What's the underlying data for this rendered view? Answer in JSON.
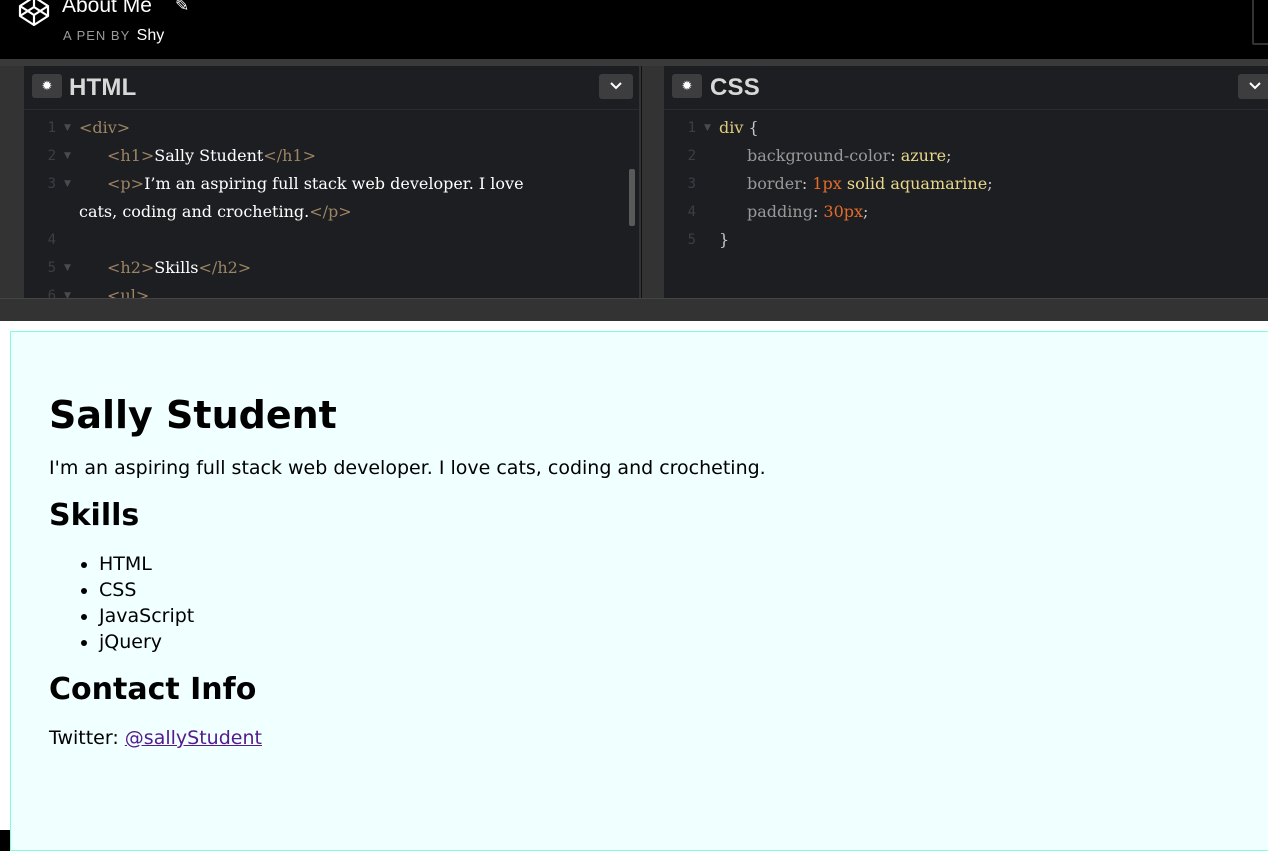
{
  "header": {
    "pen_title": "About Me",
    "byline_prefix": "A PEN BY",
    "author": "Shy"
  },
  "editors": {
    "html": {
      "title": "HTML",
      "lines": [
        {
          "n": "1",
          "fold": true,
          "parts": [
            [
              "tag",
              "<div>"
            ]
          ]
        },
        {
          "n": "2",
          "fold": true,
          "indent": true,
          "parts": [
            [
              "tag",
              "<h1>"
            ],
            [
              "text",
              "Sally Student"
            ],
            [
              "tag",
              "</h1>"
            ]
          ]
        },
        {
          "n": "3",
          "fold": true,
          "indent": true,
          "parts": [
            [
              "tag",
              "<p>"
            ],
            [
              "text",
              "I’m an aspiring full stack web developer. I love"
            ]
          ]
        },
        {
          "n": "",
          "fold": false,
          "parts": [
            [
              "text",
              "cats, coding and crocheting."
            ],
            [
              "tag",
              "</p>"
            ]
          ]
        },
        {
          "n": "4",
          "fold": false,
          "parts": []
        },
        {
          "n": "5",
          "fold": true,
          "indent": true,
          "parts": [
            [
              "tag",
              "<h2>"
            ],
            [
              "text",
              "Skills"
            ],
            [
              "tag",
              "</h2>"
            ]
          ]
        },
        {
          "n": "6",
          "fold": true,
          "indent": true,
          "parts": [
            [
              "tag",
              "<ul>"
            ]
          ]
        }
      ]
    },
    "css": {
      "title": "CSS",
      "lines": [
        {
          "n": "1",
          "fold": true,
          "parts": [
            [
              "sel",
              "div"
            ],
            [
              "punc",
              " {"
            ]
          ]
        },
        {
          "n": "2",
          "fold": false,
          "indent": true,
          "parts": [
            [
              "prop",
              "background-color"
            ],
            [
              "punc",
              ": "
            ],
            [
              "val",
              "azure"
            ],
            [
              "punc",
              ";"
            ]
          ]
        },
        {
          "n": "3",
          "fold": false,
          "indent": true,
          "parts": [
            [
              "prop",
              "border"
            ],
            [
              "punc",
              ": "
            ],
            [
              "num",
              "1px"
            ],
            [
              "val",
              " solid aquamarine"
            ],
            [
              "punc",
              ";"
            ]
          ]
        },
        {
          "n": "4",
          "fold": false,
          "indent": true,
          "parts": [
            [
              "prop",
              "padding"
            ],
            [
              "punc",
              ": "
            ],
            [
              "num",
              "30px"
            ],
            [
              "punc",
              ";"
            ]
          ]
        },
        {
          "n": "5",
          "fold": false,
          "parts": [
            [
              "punc",
              "}"
            ]
          ]
        }
      ]
    }
  },
  "preview": {
    "heading": "Sally Student",
    "intro": "I'm an aspiring full stack web developer. I love cats, coding and crocheting.",
    "skills_heading": "Skills",
    "skills": [
      "HTML",
      "CSS",
      "JavaScript",
      "jQuery"
    ],
    "contact_heading": "Contact Info",
    "twitter_label": "Twitter: ",
    "twitter_handle": "@sallyStudent"
  }
}
